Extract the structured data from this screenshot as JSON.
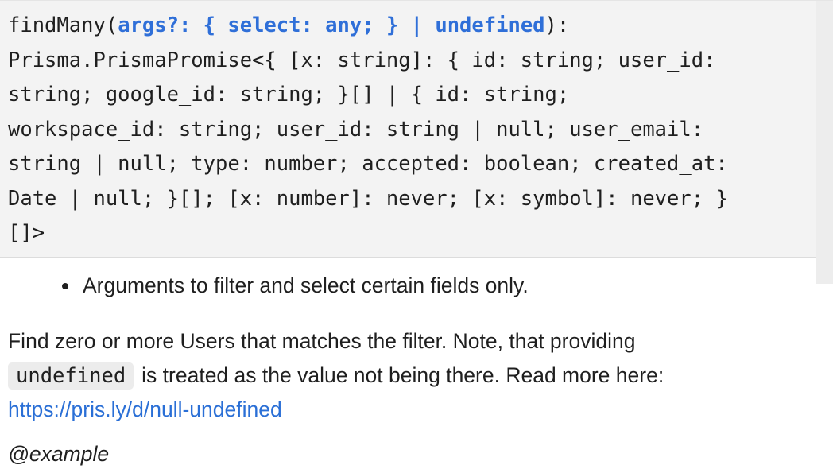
{
  "signature": {
    "fn_name": "findMany",
    "open_paren": "(",
    "param_text": "args?: { select: any; } | undefined",
    "close": "):",
    "lines": [
      "Prisma.PrismaPromise<{ [x: string]: { id: string; user_id:",
      "string; google_id: string; }[] | { id: string;",
      "workspace_id: string; user_id: string | null; user_email:",
      "string | null; type: number; accepted: boolean; created_at:",
      "Date | null; }[]; [x: number]: never; [x: symbol]: never; }",
      "[]>"
    ]
  },
  "docs": {
    "bullet": "Arguments to filter and select certain fields only.",
    "desc_line1": "Find zero or more Users that matches the filter. Note, that providing",
    "code_chip": "undefined",
    "desc_line2_rest": "is treated as the value not being there. Read more here:",
    "link": "https://pris.ly/d/null-undefined",
    "example_tag": "@example"
  },
  "colors": {
    "param": "#2f6fd8",
    "link": "#2a6fd6",
    "signature_bg": "#f3f3f3"
  }
}
